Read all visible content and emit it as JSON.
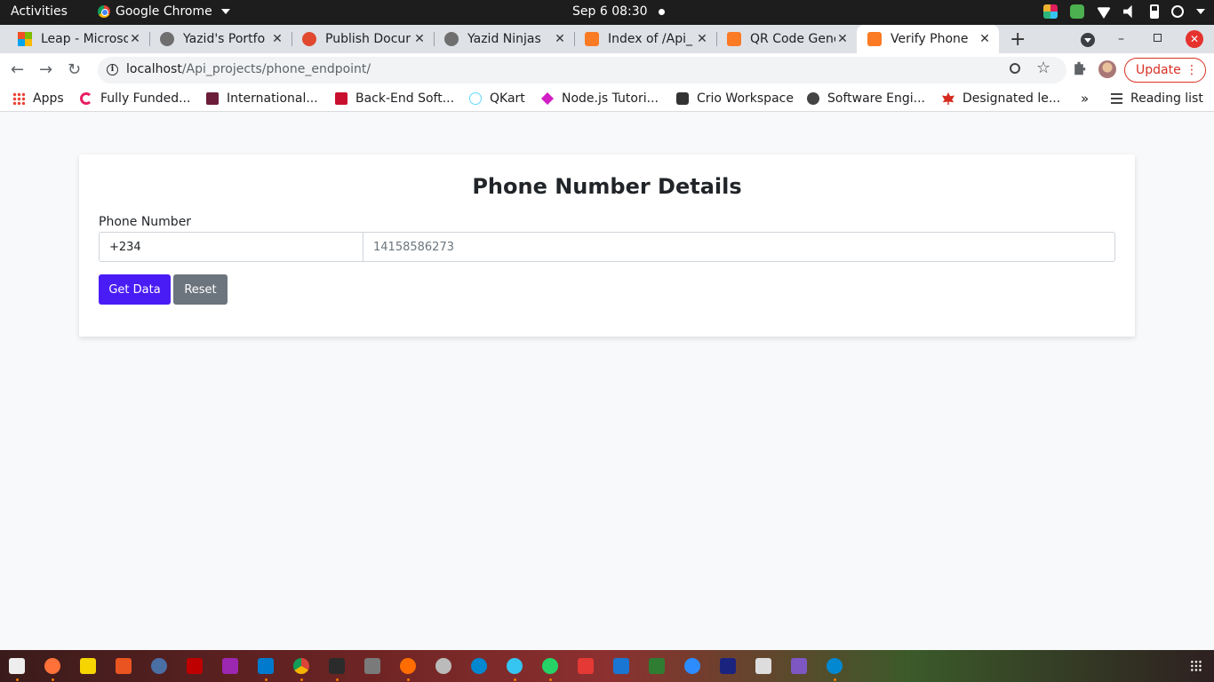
{
  "system_bar": {
    "activities": "Activities",
    "app_name": "Google Chrome",
    "datetime": "Sep 6  08:30"
  },
  "tabs": [
    {
      "title": "Leap - Microso",
      "icon": "microsoft-icon"
    },
    {
      "title": "Yazid's Portfo",
      "icon": "globe-icon"
    },
    {
      "title": "Publish Docur",
      "icon": "publish-icon"
    },
    {
      "title": "Yazid Ninjas",
      "icon": "globe-icon"
    },
    {
      "title": "Index of /Api_",
      "icon": "xampp-icon"
    },
    {
      "title": "QR Code Gene",
      "icon": "xampp-icon"
    },
    {
      "title": "Verify Phone",
      "icon": "xampp-icon",
      "active": true
    }
  ],
  "toolbar": {
    "url_host": "localhost",
    "url_path": "/Api_projects/phone_endpoint/",
    "update_label": "Update"
  },
  "bookmarks": {
    "items": [
      {
        "label": "Apps",
        "icon": "apps-icon"
      },
      {
        "label": "Fully Funded...",
        "icon": "fullyfunded-icon"
      },
      {
        "label": "International...",
        "icon": "international-icon"
      },
      {
        "label": "Back-End Soft...",
        "icon": "backend-icon"
      },
      {
        "label": "QKart",
        "icon": "react-icon"
      },
      {
        "label": "Node.js Tutori...",
        "icon": "nodejs-icon"
      },
      {
        "label": "Crio Workspace",
        "icon": "crio-icon"
      },
      {
        "label": "Software Engi...",
        "icon": "globe-icon"
      },
      {
        "label": "Designated le...",
        "icon": "maple-leaf-icon"
      }
    ],
    "more": "»",
    "reading_list": "Reading list"
  },
  "page": {
    "heading": "Phone Number Details",
    "phone_label": "Phone Number",
    "country_code_value": "+234",
    "phone_placeholder": "14158586273",
    "get_data_label": "Get Data",
    "reset_label": "Reset"
  },
  "colors": {
    "primary_button": "#4a1cf5",
    "secondary_button": "#6c757d",
    "update_red": "#d93025"
  }
}
